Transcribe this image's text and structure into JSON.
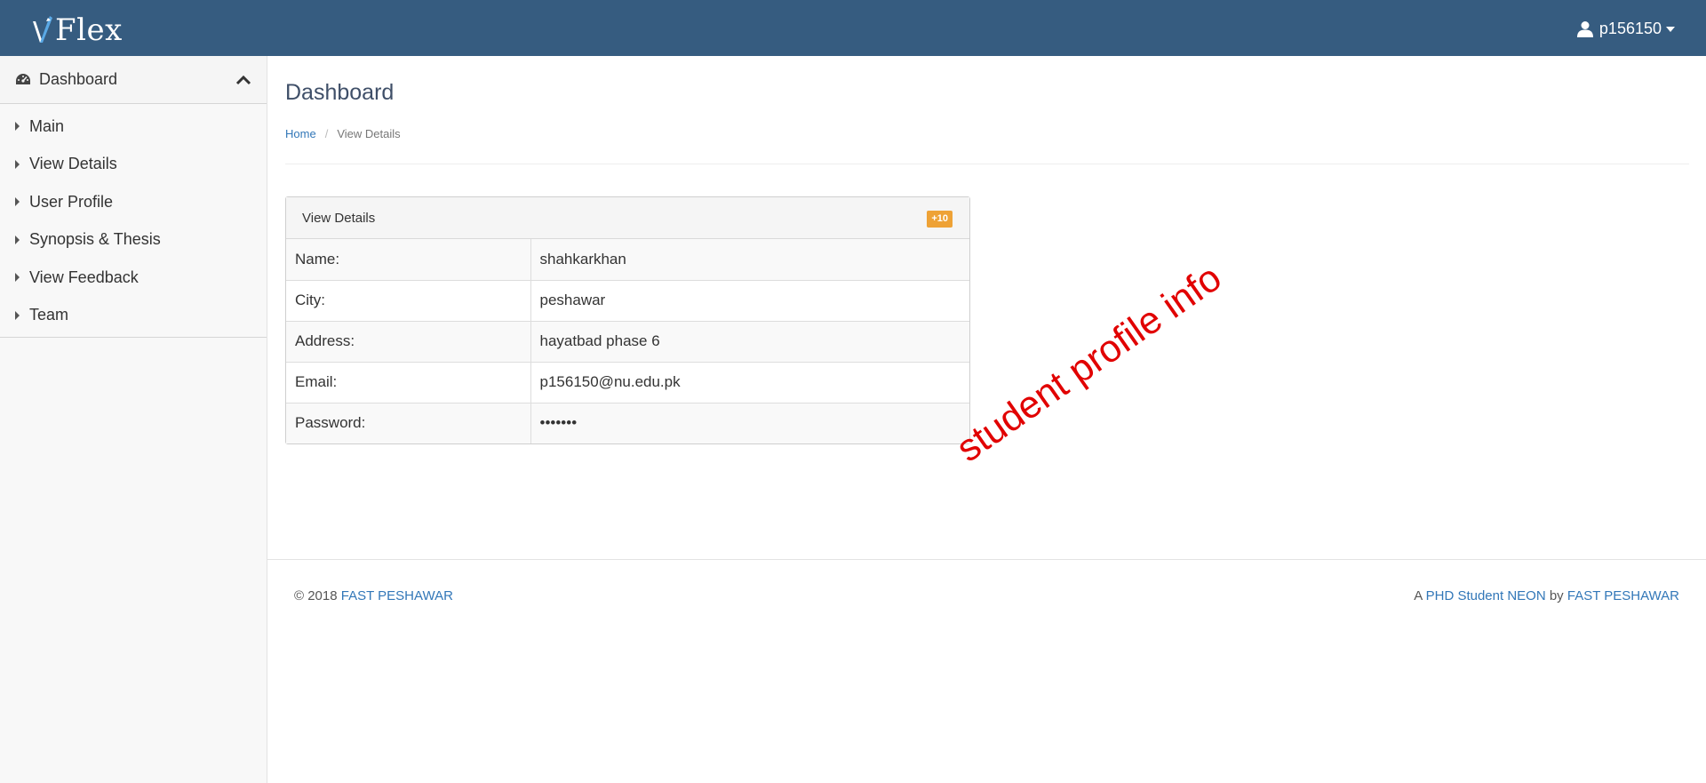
{
  "navbar": {
    "brand": "Flex",
    "username": "p156150"
  },
  "sidebar": {
    "header_label": "Dashboard",
    "items": [
      {
        "label": "Main"
      },
      {
        "label": "View Details"
      },
      {
        "label": "User Profile"
      },
      {
        "label": "Synopsis & Thesis"
      },
      {
        "label": "View Feedback"
      },
      {
        "label": "Team"
      }
    ]
  },
  "main": {
    "title": "Dashboard",
    "breadcrumb": {
      "home": "Home",
      "separator": "/",
      "current": "View Details"
    },
    "panel": {
      "title": "View Details",
      "badge": "+10",
      "rows": [
        {
          "label": "Name:",
          "value": "shahkarkhan"
        },
        {
          "label": "City:",
          "value": "peshawar"
        },
        {
          "label": "Address:",
          "value": "hayatbad phase 6"
        },
        {
          "label": "Email:",
          "value": "p156150@nu.edu.pk"
        },
        {
          "label": "Password:",
          "value": "•••••••"
        }
      ]
    },
    "annotation": "student profile info"
  },
  "footer": {
    "copyright": "© 2018",
    "org_link": "FAST PESHAWAR",
    "right_prefix": "A",
    "right_link1": "PHD Student NEON",
    "right_mid": "by",
    "right_link2": "FAST PESHAWAR"
  },
  "colors": {
    "navbar": "#365c80",
    "link": "#3277b8",
    "badge": "#eea236",
    "annotation": "#e10000"
  },
  "icons": {
    "user": "user-icon",
    "dashboard": "dashboard-gauge-icon",
    "collapse": "chevron-up-icon"
  }
}
